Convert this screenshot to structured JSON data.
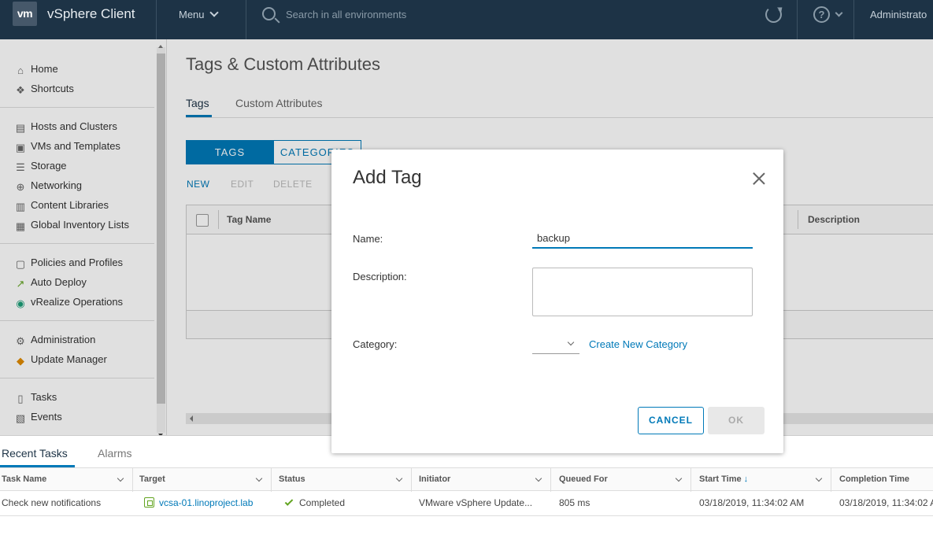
{
  "header": {
    "logo_text": "vm",
    "app_title": "vSphere Client",
    "menu_label": "Menu",
    "search_placeholder": "Search in all environments",
    "user_label": "Administrato"
  },
  "sidebar": {
    "items": [
      {
        "label": "Home",
        "icon": "home-icon"
      },
      {
        "label": "Shortcuts",
        "icon": "shortcuts-icon"
      },
      {
        "label": "Hosts and Clusters",
        "icon": "hosts-clusters-icon"
      },
      {
        "label": "VMs and Templates",
        "icon": "vms-templates-icon"
      },
      {
        "label": "Storage",
        "icon": "storage-icon"
      },
      {
        "label": "Networking",
        "icon": "networking-icon"
      },
      {
        "label": "Content Libraries",
        "icon": "content-libraries-icon"
      },
      {
        "label": "Global Inventory Lists",
        "icon": "global-inventory-icon"
      },
      {
        "label": "Policies and Profiles",
        "icon": "policies-profiles-icon"
      },
      {
        "label": "Auto Deploy",
        "icon": "auto-deploy-icon"
      },
      {
        "label": "vRealize Operations",
        "icon": "vrealize-icon"
      },
      {
        "label": "Administration",
        "icon": "administration-icon"
      },
      {
        "label": "Update Manager",
        "icon": "update-manager-icon"
      },
      {
        "label": "Tasks",
        "icon": "tasks-icon"
      },
      {
        "label": "Events",
        "icon": "events-icon"
      }
    ]
  },
  "main": {
    "page_title": "Tags & Custom Attributes",
    "tabs": [
      {
        "label": "Tags",
        "active": true
      },
      {
        "label": "Custom Attributes",
        "active": false
      }
    ],
    "toggle": {
      "tags_label": "TAGS",
      "categories_label": "CATEGORIES"
    },
    "actions": {
      "new_label": "NEW",
      "edit_label": "EDIT",
      "delete_label": "DELETE"
    },
    "grid": {
      "col_tag_name": "Tag Name",
      "col_description": "Description"
    }
  },
  "modal": {
    "title": "Add Tag",
    "name_label": "Name:",
    "name_value": "backup",
    "description_label": "Description:",
    "description_value": "",
    "category_label": "Category:",
    "category_value": "",
    "create_category_label": "Create New Category",
    "cancel_label": "CANCEL",
    "ok_label": "OK"
  },
  "bottom_panel": {
    "tabs": [
      {
        "label": "Recent Tasks",
        "active": true
      },
      {
        "label": "Alarms",
        "active": false
      }
    ],
    "columns": [
      "Task Name",
      "Target",
      "Status",
      "Initiator",
      "Queued For",
      "Start Time",
      "Completion Time"
    ],
    "rows": [
      {
        "task_name": "Check new notifications",
        "target": "vcsa-01.linoproject.lab",
        "status": "Completed",
        "initiator": "VMware vSphere Update...",
        "queued_for": "805 ms",
        "start_time": "03/18/2019, 11:34:02 AM",
        "completion_time": "03/18/2019, 11:34:02 A"
      }
    ]
  },
  "colors": {
    "header_bg": "#1d3346",
    "accent": "#0079b8",
    "success": "#62a420"
  }
}
